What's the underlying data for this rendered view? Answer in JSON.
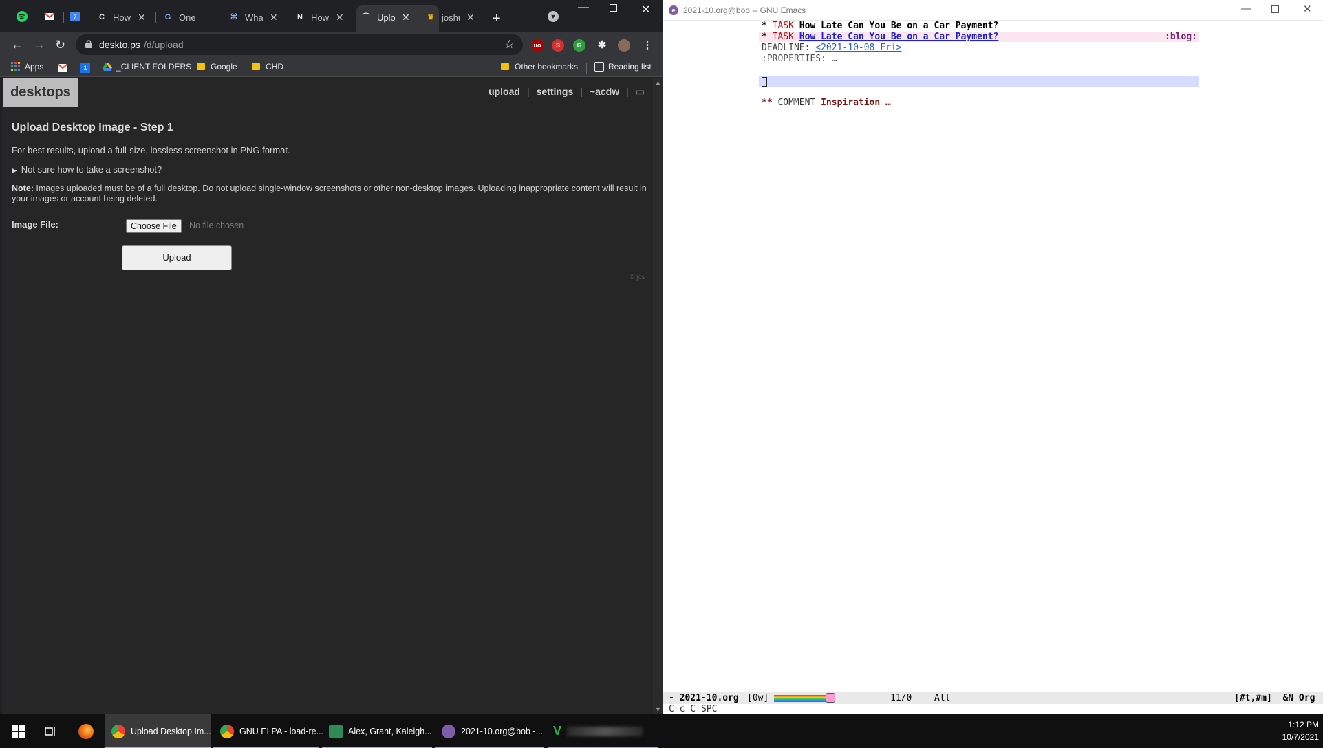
{
  "chrome": {
    "tabs": [
      {
        "title": "How t"
      },
      {
        "title": "One li"
      },
      {
        "title": "What"
      },
      {
        "title": "How t"
      },
      {
        "title": "Uploa"
      },
      {
        "title": "joshu"
      }
    ],
    "url_host": "deskto.ps",
    "url_path": "/d/upload",
    "bookmarks": {
      "apps": "Apps",
      "client_folders": "_CLIENT FOLDERS",
      "google": "Google",
      "chd": "CHD",
      "other": "Other bookmarks",
      "reading_list": "Reading list"
    }
  },
  "site": {
    "logo": "desktops",
    "nav": {
      "upload": "upload",
      "settings": "settings",
      "user": "~acdw"
    },
    "heading": "Upload Desktop Image - Step 1",
    "intro": "For best results, upload a full-size, lossless screenshot in PNG format.",
    "details_summary": "Not sure how to take a screenshot?",
    "note_label": "Note:",
    "note_text": " Images uploaded must be of a full desktop. Do not upload single-window screenshots or other non-desktop images. Uploading inappropriate content will result in your images or account being deleted.",
    "file_label": "Image File:",
    "choose_file": "Choose File",
    "no_file": "No file chosen",
    "upload_button": "Upload",
    "copyright": "© jcs"
  },
  "emacs": {
    "title": "2021-10.org@bob -- GNU Emacs",
    "line1_star": "* ",
    "line1_kw": "TASK",
    "line1_heading": "How Late Can You Be on a Car Payment?",
    "line2_star": "* ",
    "line2_kw": "TASK",
    "line2_heading": "How Late Can You Be on a Car Payment?",
    "line2_tag": ":blog:",
    "deadline_label": "DEADLINE: ",
    "deadline_date": "<2021-10-08 Fri>",
    "properties": ":PROPERTIES: …",
    "comment_stars": "** ",
    "comment_kw": "COMMENT ",
    "comment_heading": "Inspiration …",
    "modeline": {
      "left": "- 2021-10.org",
      "words": "[0w]",
      "position": "11/0",
      "scroll": "All",
      "right": "[#t,#m]  &N Org"
    },
    "echo": "C-c C-SPC"
  },
  "taskbar": {
    "apps": [
      {
        "label": "Upload Desktop Im..."
      },
      {
        "label": "GNU ELPA - load-re..."
      },
      {
        "label": "Alex, Grant, Kaleigh..."
      },
      {
        "label": "2021-10.org@bob -..."
      }
    ],
    "time": "1:12 PM",
    "date": "10/7/2021"
  },
  "colors": {
    "chrome_bg": "#202124",
    "toolbar_bg": "#35363a",
    "page_bg": "#262626",
    "emacs_keyword": "#d10000",
    "emacs_link": "#2222cc",
    "cursor_line": "#d6dcff"
  }
}
